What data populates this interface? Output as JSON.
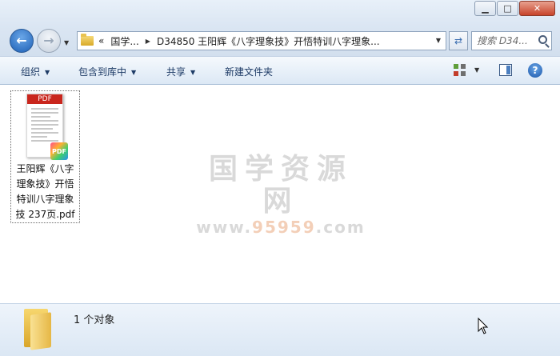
{
  "window": {
    "minimize_glyph": "▁",
    "maximize_glyph": "□",
    "close_glyph": "✕"
  },
  "address": {
    "overflow": "«",
    "crumb1": "国学...",
    "crumb2": "D34850 王阳辉《八字理象技》开悟特训八字理象...",
    "search_placeholder": "搜索 D34..."
  },
  "toolbar": {
    "organize": "组织",
    "include_library": "包含到库中",
    "share": "共享",
    "new_folder": "新建文件夹"
  },
  "file": {
    "name": "王阳辉《八字理象技》开悟特训八字理象技 237页.pdf",
    "thumb_label": "PDF",
    "badge_label": "PDF"
  },
  "watermark": {
    "title": "国学资源网",
    "url_prefix": "www.",
    "url_highlight": "95959",
    "url_suffix": ".com"
  },
  "status": {
    "count": "1 个对象"
  },
  "colors": {
    "accent": "#1d5fb5",
    "pdf_red": "#c9261d"
  }
}
